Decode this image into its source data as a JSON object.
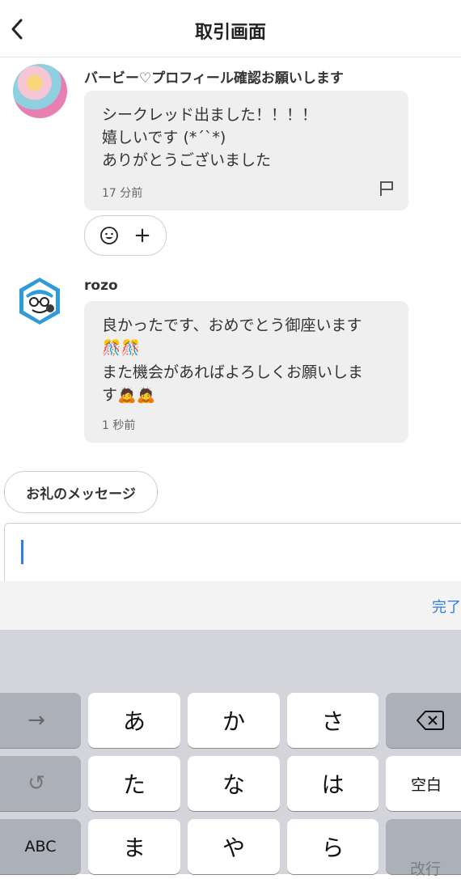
{
  "header": {
    "title": "取引画面",
    "back_icon": "chevron-left-icon"
  },
  "messages": [
    {
      "sender": "バービー♡プロフィール確認お願いします",
      "lines": [
        "シークレッド出ました！！！！",
        "嬉しいです (*´`*)",
        "ありがとうございました"
      ],
      "time": "17 分前"
    },
    {
      "sender": "rozo",
      "lines": [
        "良かったです、おめでとう御座います",
        "🎊🎊",
        "また機会があればよろしくお願いしま",
        "す🙇🙇"
      ],
      "time": "1 秒前"
    }
  ],
  "reaction": {
    "plus": "+"
  },
  "thanks_button": "お礼のメッセージ",
  "toolbar": {
    "done": "完了"
  },
  "keyboard": {
    "row1": [
      "→",
      "あ",
      "か",
      "さ",
      "⌫"
    ],
    "row2": [
      "↺",
      "た",
      "な",
      "は",
      "空白"
    ],
    "row3": [
      "ABC",
      "ま",
      "や",
      "ら",
      "改行"
    ]
  }
}
